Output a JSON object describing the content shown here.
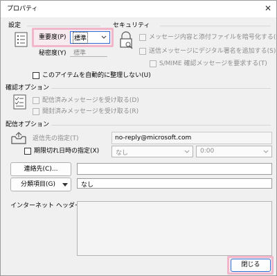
{
  "window": {
    "title": "プロパティ",
    "close_glyph": "✕"
  },
  "settings": {
    "section_label": "設定",
    "importance_label": "重要度(P)",
    "importance_value": "標準",
    "sensitivity_label": "秘密度(Y)",
    "sensitivity_value": "標準",
    "auto_archive_label": "このアイテムを自動的に整理しない(U)"
  },
  "security": {
    "section_label": "セキュリティ",
    "encrypt_label": "メッセージ内容と添付ファイルを暗号化する(E)",
    "sign_label": "送信メッセージにデジタル署名を追加する(S)",
    "smime_label": "S/MIME 確認メッセージを要求する(T)"
  },
  "tracking": {
    "section_label": "確認オプション",
    "delivery_label": "配信済みメッセージを受け取る(D)",
    "read_label": "開封済みメッセージを受け取る(R)"
  },
  "delivery": {
    "section_label": "配信オプション",
    "replies_label": "返信先の指定(T)",
    "replies_value": "no-reply@microsoft.com",
    "expires_label": "期限切れ日時の指定(X)",
    "expires_date": "なし",
    "expires_time": "0:00"
  },
  "contacts": {
    "button_label": "連絡先(C)...",
    "value": ""
  },
  "categories": {
    "button_label": "分類項目(G)",
    "value": "なし"
  },
  "headers": {
    "label": "インターネット ヘッダー(H)",
    "value": ""
  },
  "footer": {
    "close_label": "閉じる"
  },
  "colors": {
    "highlight": "#f2b6cc",
    "focus_blue": "#2a6fd6"
  },
  "icons": [
    "settings-list-icon",
    "lock-icon",
    "tracking-list-icon",
    "envelope-tray-icon",
    "chevron-down-icon"
  ]
}
